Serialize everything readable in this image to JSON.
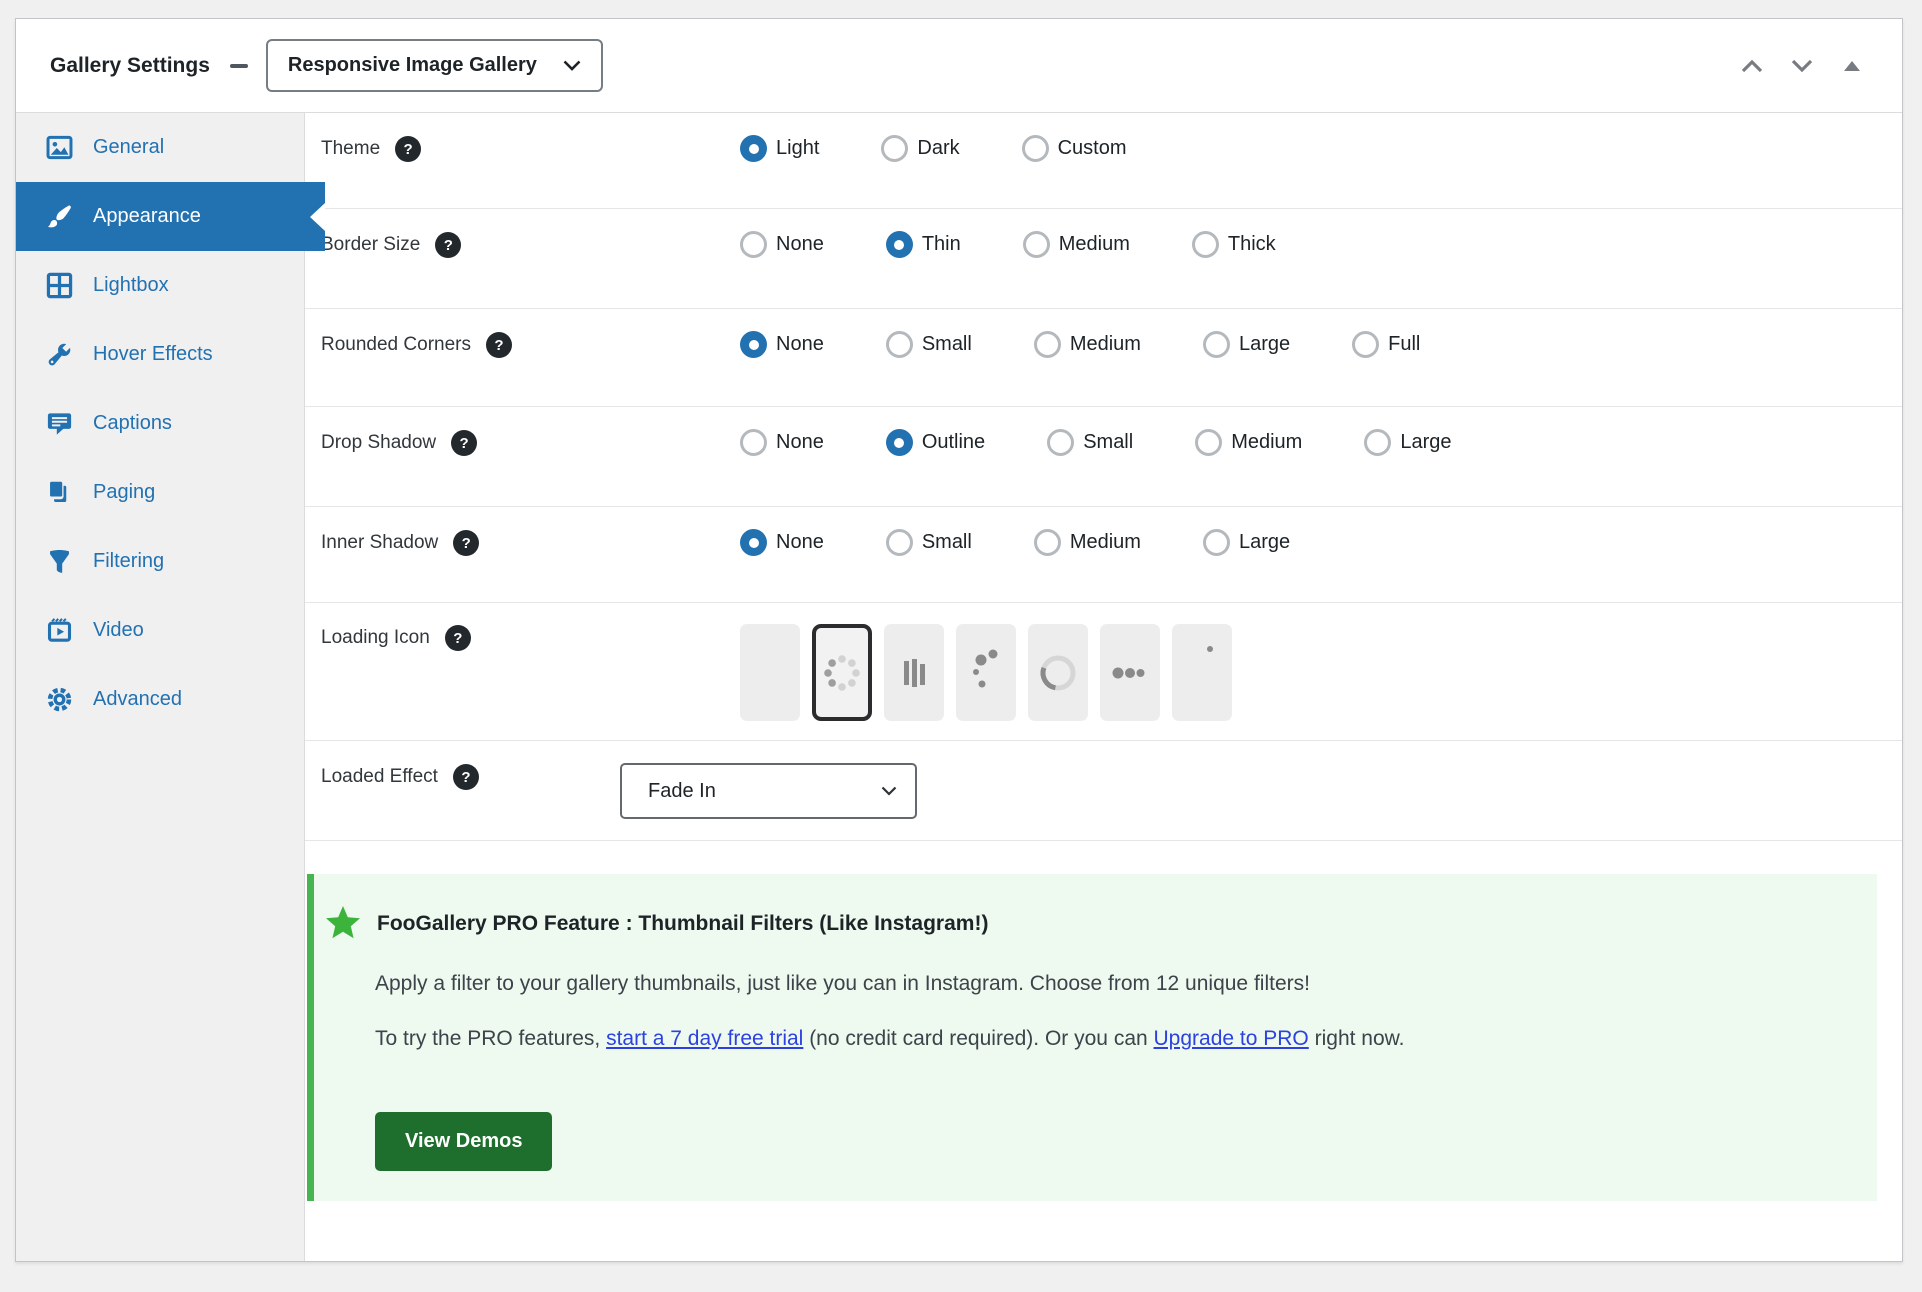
{
  "header": {
    "title": "Gallery Settings",
    "collapse_dash_icon": "minus-icon",
    "template_dropdown": {
      "value": "Responsive Image Gallery",
      "icon": "chevron-down-icon"
    },
    "actions": [
      {
        "icon": "move-up-icon"
      },
      {
        "icon": "move-down-icon"
      },
      {
        "icon": "collapse-panel-icon"
      }
    ]
  },
  "sidebar": {
    "items": [
      {
        "label": "General",
        "icon": "image-icon",
        "active": false
      },
      {
        "label": "Appearance",
        "icon": "brush-icon",
        "active": true
      },
      {
        "label": "Lightbox",
        "icon": "grid-window-icon",
        "active": false
      },
      {
        "label": "Hover Effects",
        "icon": "wrench-icon",
        "active": false
      },
      {
        "label": "Captions",
        "icon": "speech-bubble-icon",
        "active": false
      },
      {
        "label": "Paging",
        "icon": "pages-icon",
        "active": false
      },
      {
        "label": "Filtering",
        "icon": "funnel-icon",
        "active": false
      },
      {
        "label": "Video",
        "icon": "video-icon",
        "active": false
      },
      {
        "label": "Advanced",
        "icon": "gear-icon",
        "active": false
      }
    ]
  },
  "glyphs": {
    "question": "?"
  },
  "rows": [
    {
      "label": "Theme",
      "options": [
        {
          "label": "Light",
          "selected": true
        },
        {
          "label": "Dark",
          "selected": false
        },
        {
          "label": "Custom",
          "selected": false
        }
      ]
    },
    {
      "label": "Border Size",
      "options": [
        {
          "label": "None",
          "selected": false
        },
        {
          "label": "Thin",
          "selected": true
        },
        {
          "label": "Medium",
          "selected": false
        },
        {
          "label": "Thick",
          "selected": false
        }
      ]
    },
    {
      "label": "Rounded Corners",
      "options": [
        {
          "label": "None",
          "selected": true
        },
        {
          "label": "Small",
          "selected": false
        },
        {
          "label": "Medium",
          "selected": false
        },
        {
          "label": "Large",
          "selected": false
        },
        {
          "label": "Full",
          "selected": false
        }
      ]
    },
    {
      "label": "Drop Shadow",
      "options": [
        {
          "label": "None",
          "selected": false
        },
        {
          "label": "Outline",
          "selected": true
        },
        {
          "label": "Small",
          "selected": false
        },
        {
          "label": "Medium",
          "selected": false
        },
        {
          "label": "Large",
          "selected": false
        }
      ]
    },
    {
      "label": "Inner Shadow",
      "options": [
        {
          "label": "None",
          "selected": true
        },
        {
          "label": "Small",
          "selected": false
        },
        {
          "label": "Medium",
          "selected": false
        },
        {
          "label": "Large",
          "selected": false
        }
      ]
    },
    {
      "label": "Loading Icon",
      "tiles": [
        {
          "name": "no-icon",
          "selected": false
        },
        {
          "name": "dotted-spinner",
          "selected": true
        },
        {
          "name": "bars",
          "selected": false
        },
        {
          "name": "trail-dots",
          "selected": false
        },
        {
          "name": "ring-spinner",
          "selected": false
        },
        {
          "name": "three-dots",
          "selected": false
        },
        {
          "name": "pulse-dot",
          "selected": false
        }
      ]
    },
    {
      "label": "Loaded Effect",
      "select_value": "Fade In"
    }
  ],
  "pro_box": {
    "icon": "star-icon",
    "heading": "FooGallery PRO Feature : Thumbnail Filters (Like Instagram!)",
    "p1": "Apply a filter to your gallery thumbnails, just like you can in Instagram. Choose from 12 unique filters!",
    "p2_before": "To try the PRO features, ",
    "trial_link": "start a 7 day free trial",
    "p2_middle": " (no credit card required). Or you can ",
    "upgrade_link": "Upgrade to PRO",
    "p2_after": " right now.",
    "button": "View Demos"
  },
  "colors": {
    "accent": "#2271b1",
    "sidebar_bg": "#f0f0f1",
    "pro_green": "#46b450",
    "pro_bg": "#eef9ef",
    "button_green": "#1e6f2d",
    "link_blue": "#2c41e0",
    "help_bg": "#23282d"
  }
}
